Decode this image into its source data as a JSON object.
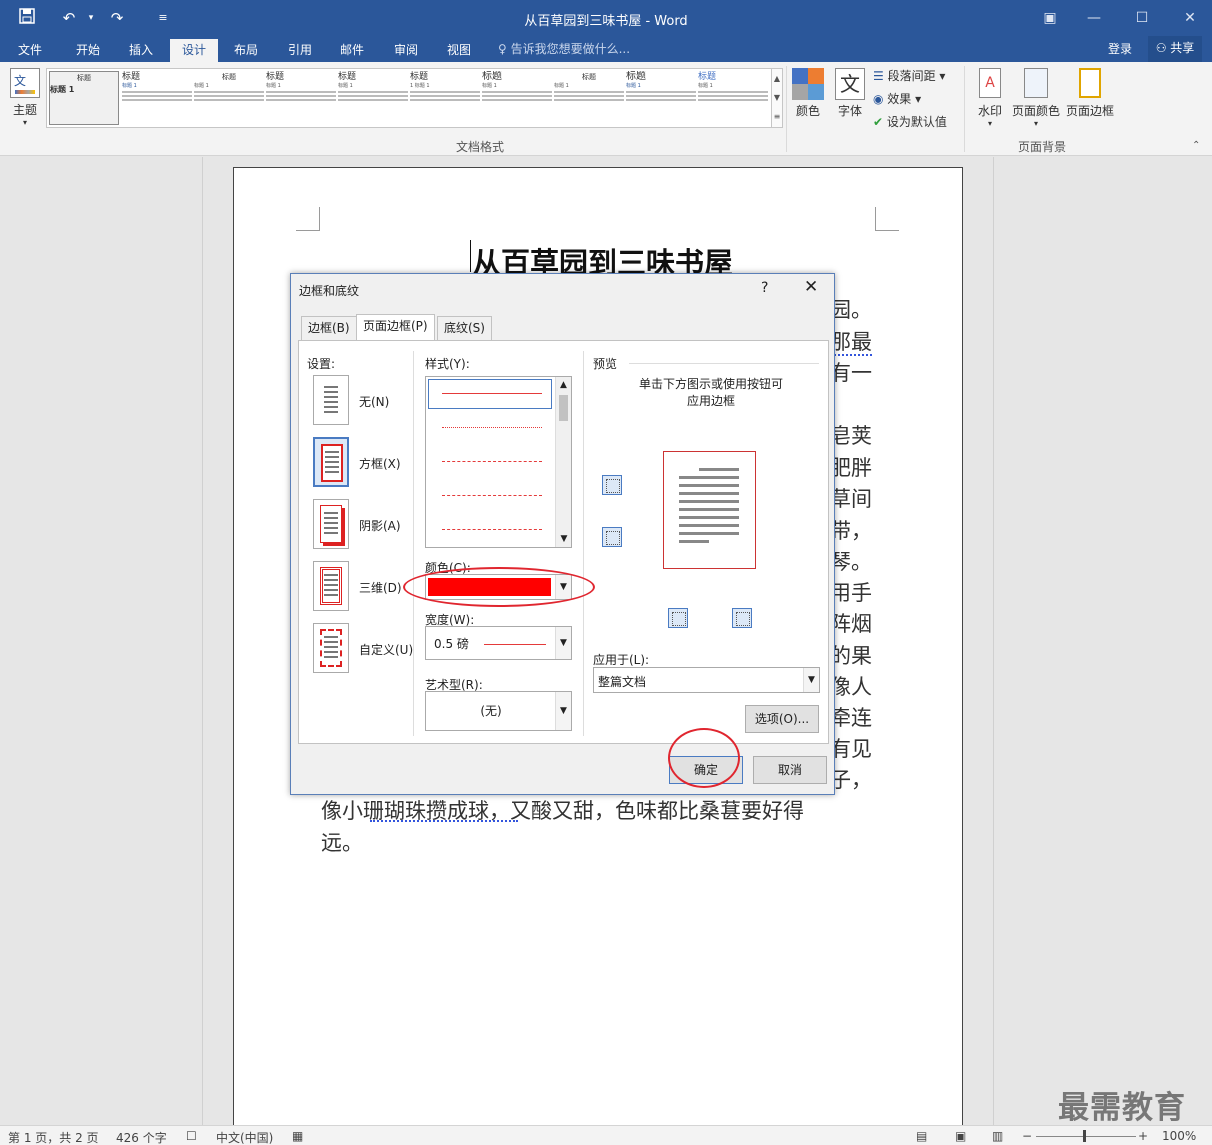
{
  "window": {
    "title": "从百草园到三味书屋 - Word"
  },
  "menu": {
    "tabs": [
      "文件",
      "开始",
      "插入",
      "设计",
      "布局",
      "引用",
      "邮件",
      "审阅",
      "视图"
    ],
    "active_tab": "设计",
    "tell_me": "告诉我您想要做什么...",
    "login": "登录",
    "share": "共享"
  },
  "ribbon": {
    "theme_label": "主题",
    "gallery": [
      {
        "h": "标题",
        "sub": "标题 1"
      },
      {
        "h": "标题",
        "sub": "标题 1"
      },
      {
        "h": "标题",
        "sub": "标题 1"
      },
      {
        "h": "标题",
        "sub": "标题 1"
      },
      {
        "h": "标题",
        "sub": "标题 1"
      },
      {
        "h": "标题",
        "sub": "1 标题 1"
      },
      {
        "h": "标题",
        "sub": "标题 1"
      },
      {
        "h": "标题",
        "sub": "标题 1"
      },
      {
        "h": "标题",
        "sub": "标题 1"
      },
      {
        "h": "标题",
        "sub": "标题 1"
      }
    ],
    "doc_format_label": "文档格式",
    "colors_label": "颜色",
    "fonts_label": "字体",
    "paragraph_spacing": "段落间距",
    "effects": "效果",
    "set_default": "设为默认值",
    "watermark": "水印",
    "page_color": "页面颜色",
    "page_border": "页面边框",
    "page_bg_label": "页面背景"
  },
  "document": {
    "title": "从百草园到三味书屋",
    "right_chars": [
      "园。",
      "那最",
      "有一",
      "皂荚",
      "肥胖",
      "草间",
      "带，",
      "琴。",
      "用手",
      "阵烟",
      "的果",
      "像人",
      "牵连",
      "有见",
      "子，"
    ],
    "line1": "像小珊瑚珠攒成球，又酸又甜，色味都比桑葚要好得",
    "line2": "远。"
  },
  "dialog": {
    "title": "边框和底纹",
    "help": "?",
    "tabs": [
      "边框(B)",
      "页面边框(P)",
      "底纹(S)"
    ],
    "settings_label": "设置:",
    "settings": [
      "无(N)",
      "方框(X)",
      "阴影(A)",
      "三维(D)",
      "自定义(U)"
    ],
    "style_label": "样式(Y):",
    "color_label": "颜色(C):",
    "color_value": "#ff0000",
    "width_label": "宽度(W):",
    "width_value": "0.5 磅",
    "art_label": "艺术型(R):",
    "art_value": "(无)",
    "preview_label": "预览",
    "preview_hint_1": "单击下方图示或使用按钮可",
    "preview_hint_2": "应用边框",
    "apply_label": "应用于(L):",
    "apply_value": "整篇文档",
    "options_button": "选项(O)...",
    "ok_button": "确定",
    "cancel_button": "取消"
  },
  "status": {
    "page": "第 1 页，共 2 页",
    "words": "426 个字",
    "language": "中文(中国)",
    "zoom": "100%"
  },
  "watermark_text": "最需教育"
}
